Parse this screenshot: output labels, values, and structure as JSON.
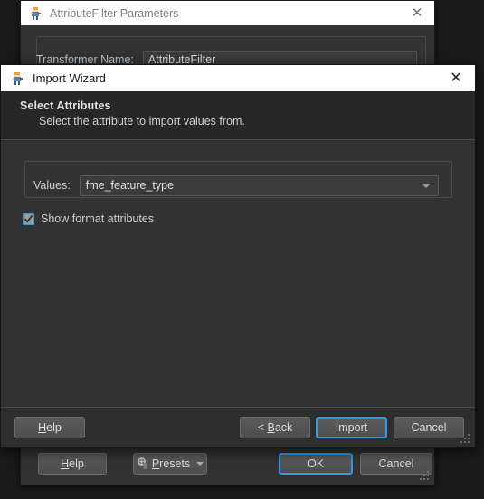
{
  "background_dialog": {
    "title": "AttributeFilter Parameters",
    "icon": "fme-logo-icon",
    "close_label": "✕",
    "transformer_name_label": "Transformer Name:",
    "transformer_name_value": "AttributeFilter",
    "footer": {
      "help_label": "Help",
      "help_mnemonic": "H",
      "presets_label": "Presets",
      "presets_mnemonic": "P",
      "ok_label": "OK",
      "cancel_label": "Cancel"
    }
  },
  "wizard": {
    "title": "Import Wizard",
    "icon": "fme-logo-icon",
    "close_label": "✕",
    "header": {
      "title": "Select Attributes",
      "subtitle": "Select the attribute to import values from."
    },
    "values": {
      "label": "Values:",
      "selected": "fme_feature_type",
      "options": [
        "fme_feature_type"
      ]
    },
    "show_format_attributes": {
      "label": "Show format attributes",
      "checked": true
    },
    "footer": {
      "help_label": "Help",
      "help_mnemonic": "H",
      "back_label": "< Back",
      "back_mnemonic": "B",
      "import_label": "Import",
      "cancel_label": "Cancel"
    }
  },
  "colors": {
    "accent_blue": "#2f9de0",
    "dialog_bg": "#323232",
    "wizard_bg": "#2e2e2e",
    "header_bg": "#272727",
    "titlebar_bg": "#ffffff",
    "text": "#d4d4d4",
    "label_blue": "#b9c5cf"
  }
}
